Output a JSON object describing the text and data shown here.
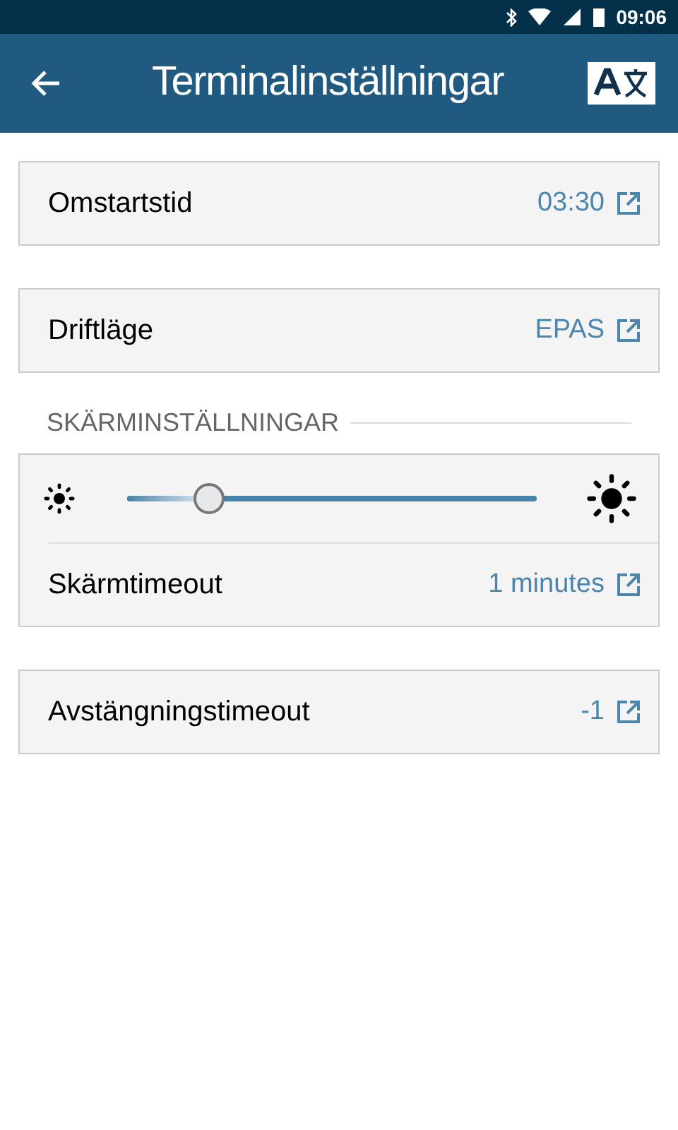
{
  "status_bar": {
    "time": "09:06"
  },
  "header": {
    "title": "Terminalinställningar"
  },
  "cards": [
    {
      "kind": "setting",
      "label": "Omstartstid",
      "value": "03:30"
    },
    {
      "kind": "setting",
      "label": "Driftläge",
      "value": "EPAS"
    },
    {
      "kind": "section",
      "title": "SKÄRMINSTÄLLNINGAR"
    },
    {
      "kind": "brightness",
      "level": 0.2,
      "label": "Skärmtimeout",
      "value": "1 minutes"
    },
    {
      "kind": "setting",
      "label": "Avstängningstimeout",
      "value": "-1"
    }
  ]
}
